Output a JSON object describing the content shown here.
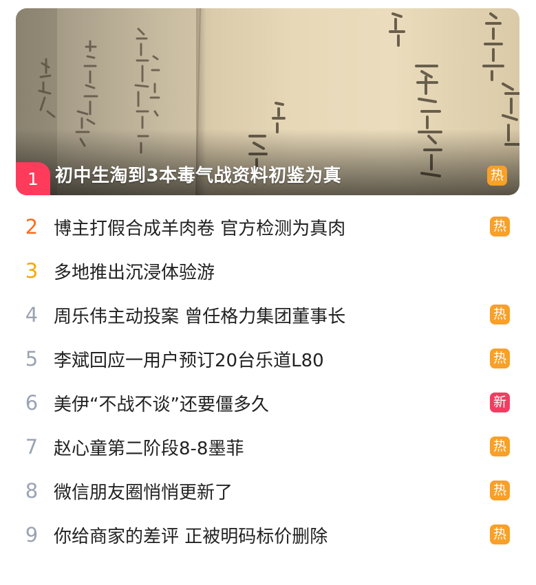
{
  "colors": {
    "hot": "#f8a028",
    "new": "#f23d62",
    "rank_first": "#ff3b5c",
    "rank_second": "#ff6a1a",
    "rank_third": "#f7a600",
    "rank_other": "#9aa3b2"
  },
  "featured": {
    "rank": "1",
    "title": "初中生淘到3本毒气战资料初鉴为真",
    "badge": "热",
    "badge_type": "hot",
    "image_icon": "old-document-photo"
  },
  "list": [
    {
      "rank": "2",
      "title": "博主打假合成羊肉卷 官方检测为真肉",
      "badge": "热",
      "badge_type": "hot"
    },
    {
      "rank": "3",
      "title": "多地推出沉浸体验游",
      "badge": "",
      "badge_type": "none"
    },
    {
      "rank": "4",
      "title": "周乐伟主动投案 曾任格力集团董事长",
      "badge": "热",
      "badge_type": "hot"
    },
    {
      "rank": "5",
      "title": "李斌回应一用户预订20台乐道L80",
      "badge": "热",
      "badge_type": "hot"
    },
    {
      "rank": "6",
      "title": "美伊“不战不谈”还要僵多久",
      "badge": "新",
      "badge_type": "new"
    },
    {
      "rank": "7",
      "title": "赵心童第二阶段8-8墨菲",
      "badge": "热",
      "badge_type": "hot"
    },
    {
      "rank": "8",
      "title": "微信朋友圈悄悄更新了",
      "badge": "热",
      "badge_type": "hot"
    },
    {
      "rank": "9",
      "title": "你给商家的差评 正被明码标价删除",
      "badge": "热",
      "badge_type": "hot"
    }
  ]
}
